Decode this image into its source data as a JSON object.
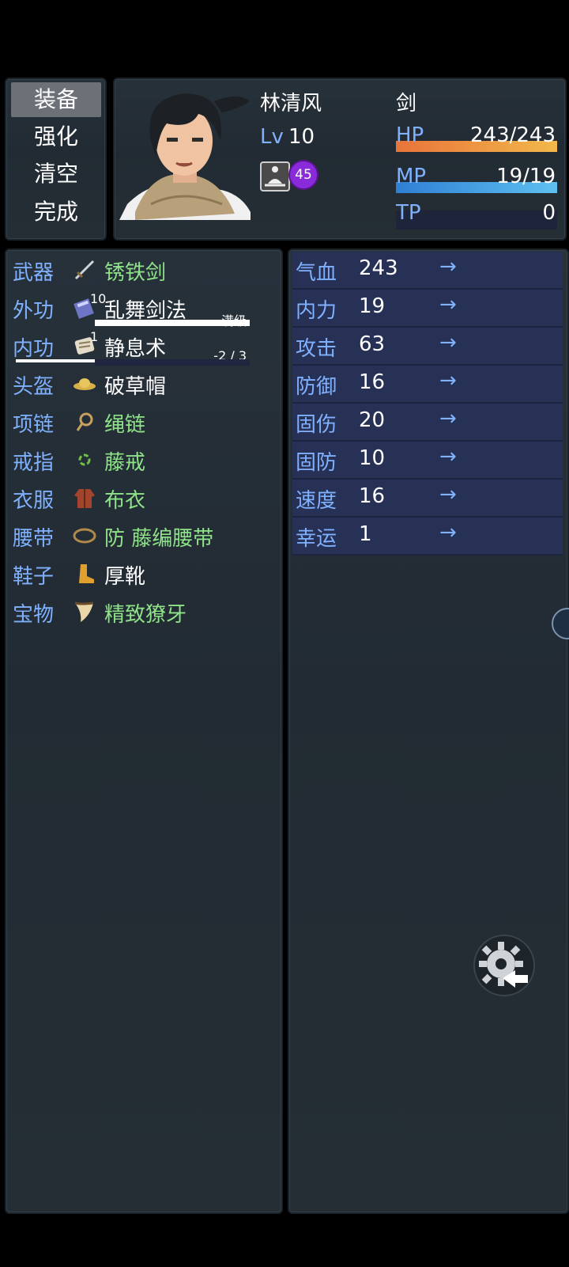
{
  "commands": [
    "装备",
    "强化",
    "清空",
    "完成"
  ],
  "actor": {
    "name": "林清风",
    "class": "剑",
    "level_label": "Lv",
    "level": "10",
    "badge": "45",
    "hp": {
      "label": "HP",
      "value": "243/243",
      "ratio": 1.0
    },
    "mp": {
      "label": "MP",
      "value": "19/19",
      "ratio": 1.0
    },
    "tp": {
      "label": "TP",
      "value": "0",
      "ratio": 0.0
    }
  },
  "slots": [
    {
      "slot": "武器",
      "icon": "sword-icon",
      "item": "锈铁剑",
      "color": "green"
    },
    {
      "slot": "外功",
      "icon": "book-icon",
      "item": "乱舞剑法",
      "color": "white",
      "level": "10",
      "note": "满级"
    },
    {
      "slot": "内功",
      "icon": "scroll-icon",
      "item": "静息术",
      "color": "white",
      "level": "1",
      "note": "-2 / 3"
    },
    {
      "slot": "头盔",
      "icon": "straw-hat-icon",
      "item": "破草帽",
      "color": "white"
    },
    {
      "slot": "项链",
      "icon": "rope-necklace-icon",
      "item": "绳链",
      "color": "green"
    },
    {
      "slot": "戒指",
      "icon": "ring-icon",
      "item": "藤戒",
      "color": "green"
    },
    {
      "slot": "衣服",
      "icon": "robe-icon",
      "item": "布衣",
      "color": "green"
    },
    {
      "slot": "腰带",
      "icon": "belt-icon",
      "item": "防 藤编腰带",
      "color": "green"
    },
    {
      "slot": "鞋子",
      "icon": "boot-icon",
      "item": "厚靴",
      "color": "white"
    },
    {
      "slot": "宝物",
      "icon": "fang-icon",
      "item": "精致獠牙",
      "color": "green"
    }
  ],
  "params": [
    {
      "name": "气血",
      "value": "243",
      "arrow": "→"
    },
    {
      "name": "内力",
      "value": "19",
      "arrow": "→"
    },
    {
      "name": "攻击",
      "value": "63",
      "arrow": "→"
    },
    {
      "name": "防御",
      "value": "16",
      "arrow": "→"
    },
    {
      "name": "固伤",
      "value": "20",
      "arrow": "→"
    },
    {
      "name": "固防",
      "value": "10",
      "arrow": "→"
    },
    {
      "name": "速度",
      "value": "16",
      "arrow": "→"
    },
    {
      "name": "幸运",
      "value": "1",
      "arrow": "→"
    }
  ],
  "colors": {
    "hp_gradient": [
      "#e8743a",
      "#f2b84a"
    ],
    "mp_gradient": [
      "#2f7fd4",
      "#5ec0f0"
    ],
    "system_blue": "#7fb1ff",
    "equip_green": "#8fe388"
  }
}
